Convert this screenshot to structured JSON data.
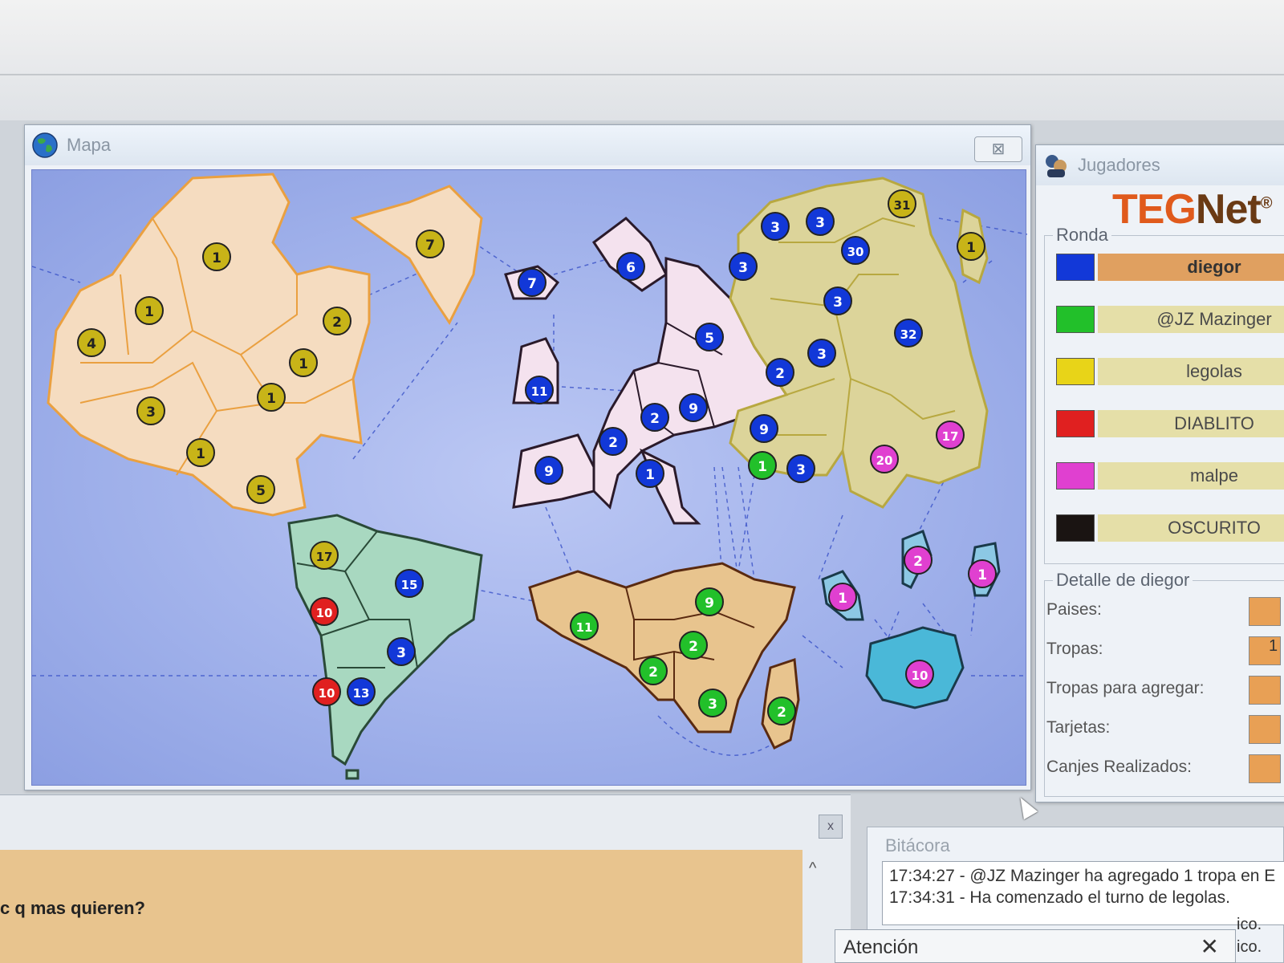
{
  "map_window": {
    "title": "Mapa",
    "close_glyph": "⊠",
    "icon": "globe-icon"
  },
  "players_window": {
    "title": "Jugadores",
    "icon": "players-icon",
    "logo_teg": "TEG",
    "logo_net": "Net",
    "logo_mark": "®",
    "round_label": "Ronda",
    "players": [
      {
        "name": "diegor",
        "color": "#1238d8",
        "active": true
      },
      {
        "name": "@JZ Mazinger",
        "color": "#22c02a",
        "active": false
      },
      {
        "name": "legolas",
        "color": "#e8d418",
        "active": false
      },
      {
        "name": "DIABLITO",
        "color": "#e02020",
        "active": false
      },
      {
        "name": "malpe",
        "color": "#e040d0",
        "active": false
      },
      {
        "name": "OSCURITO",
        "color": "#1a1412",
        "active": false
      }
    ],
    "detail_label": "Detalle de diegor",
    "detail_fields": [
      {
        "label": "Paises:",
        "value": ""
      },
      {
        "label": "Tropas:",
        "value": "1"
      },
      {
        "label": "Tropas para agregar:",
        "value": ""
      },
      {
        "label": "Tarjetas:",
        "value": ""
      },
      {
        "label": "Canjes Realizados:",
        "value": ""
      }
    ]
  },
  "chat": {
    "close_glyph": "x",
    "text": "c q mas quieren?",
    "scroll_up_glyph": "^"
  },
  "log": {
    "title": "Bitácora",
    "lines": [
      "17:34:27 - @JZ Mazinger ha agregado 1 tropa en E",
      "17:34:31 - Ha comenzado el turno de legolas."
    ],
    "tail1": "ico.",
    "tail2": "ico."
  },
  "alert": {
    "title": "Atención",
    "close_glyph": "✕"
  },
  "colors": {
    "north_america": "#f5dcc0",
    "south_america": "#a8d8c0",
    "europe": "#f4e2ee",
    "asia": "#dcd49a",
    "africa": "#e8c48e",
    "oceania": "#8cc8e4",
    "blue": "#1238d8",
    "green": "#22c02a",
    "yellow": "#c8b418",
    "red": "#e02020",
    "magenta": "#e040d0"
  },
  "armies": [
    {
      "owner": "yellow",
      "troops": "1"
    },
    {
      "owner": "yellow",
      "troops": "1"
    },
    {
      "owner": "yellow",
      "troops": "4"
    },
    {
      "owner": "yellow",
      "troops": "2"
    },
    {
      "owner": "yellow",
      "troops": "1"
    },
    {
      "owner": "yellow",
      "troops": "1"
    },
    {
      "owner": "yellow",
      "troops": "3"
    },
    {
      "owner": "yellow",
      "troops": "1"
    },
    {
      "owner": "yellow",
      "troops": "5"
    },
    {
      "owner": "yellow",
      "troops": "7"
    },
    {
      "owner": "blue",
      "troops": "7"
    },
    {
      "owner": "blue",
      "troops": "6"
    },
    {
      "owner": "blue",
      "troops": "11"
    },
    {
      "owner": "blue",
      "troops": "5"
    },
    {
      "owner": "blue",
      "troops": "2"
    },
    {
      "owner": "blue",
      "troops": "9"
    },
    {
      "owner": "blue",
      "troops": "2"
    },
    {
      "owner": "blue",
      "troops": "9"
    },
    {
      "owner": "blue",
      "troops": "1"
    },
    {
      "owner": "blue",
      "troops": "3"
    },
    {
      "owner": "blue",
      "troops": "3"
    },
    {
      "owner": "yellow",
      "troops": "31"
    },
    {
      "owner": "blue",
      "troops": "3"
    },
    {
      "owner": "blue",
      "troops": "30"
    },
    {
      "owner": "blue",
      "troops": "3"
    },
    {
      "owner": "blue",
      "troops": "32"
    },
    {
      "owner": "blue",
      "troops": "3"
    },
    {
      "owner": "blue",
      "troops": "2"
    },
    {
      "owner": "blue",
      "troops": "9"
    },
    {
      "owner": "green",
      "troops": "1"
    },
    {
      "owner": "blue",
      "troops": "3"
    },
    {
      "owner": "magenta",
      "troops": "20"
    },
    {
      "owner": "magenta",
      "troops": "17"
    },
    {
      "owner": "yellow",
      "troops": "1"
    },
    {
      "owner": "yellow",
      "troops": "17"
    },
    {
      "owner": "blue",
      "troops": "15"
    },
    {
      "owner": "red",
      "troops": "10"
    },
    {
      "owner": "blue",
      "troops": "3"
    },
    {
      "owner": "red",
      "troops": "10"
    },
    {
      "owner": "blue",
      "troops": "13"
    },
    {
      "owner": "green",
      "troops": "11"
    },
    {
      "owner": "green",
      "troops": "9"
    },
    {
      "owner": "green",
      "troops": "2"
    },
    {
      "owner": "green",
      "troops": "2"
    },
    {
      "owner": "green",
      "troops": "3"
    },
    {
      "owner": "green",
      "troops": "2"
    },
    {
      "owner": "magenta",
      "troops": "1"
    },
    {
      "owner": "magenta",
      "troops": "2"
    },
    {
      "owner": "magenta",
      "troops": "1"
    },
    {
      "owner": "magenta",
      "troops": "10"
    }
  ]
}
